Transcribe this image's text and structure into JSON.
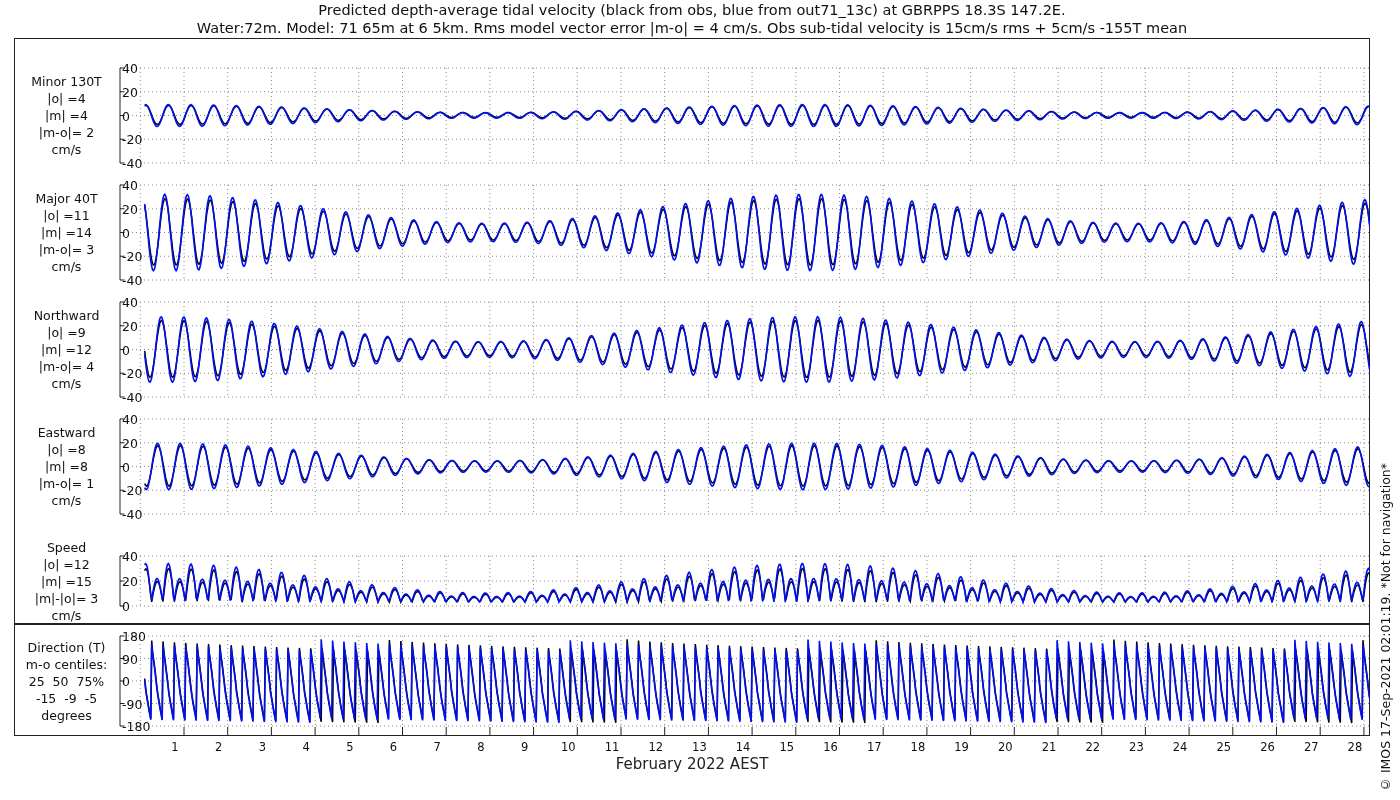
{
  "title_lines": [
    "Predicted depth-average tidal velocity (black from obs, blue from out71_13c) at GBRPPS 18.3S 147.2E.",
    "Water:72m. Model: 71 65m at 6 5km. Rms model vector error |m-o| = 4 cm/s. Obs sub-tidal velocity is 15cm/s rms + 5cm/s -155T mean"
  ],
  "panels": [
    {
      "kind": "velocity",
      "labels": [
        "Minor 130T",
        "|o| =4",
        "|m| =4",
        "|m-o|= 2",
        "cm/s"
      ],
      "yticks": [
        "40",
        "20",
        "0",
        "-20",
        "-40"
      ]
    },
    {
      "kind": "velocity",
      "labels": [
        "Major 40T",
        "|o| =11",
        "|m| =14",
        "|m-o|= 3",
        "cm/s"
      ],
      "yticks": [
        "40",
        "20",
        "0",
        "-20",
        "-40"
      ]
    },
    {
      "kind": "velocity",
      "labels": [
        "Northward",
        "|o| =9",
        "|m| =12",
        "|m-o|= 4",
        "cm/s"
      ],
      "yticks": [
        "40",
        "20",
        "0",
        "-20",
        "-40"
      ]
    },
    {
      "kind": "velocity",
      "labels": [
        "Eastward",
        "|o| =8",
        "|m| =8",
        "|m-o|= 1",
        "cm/s"
      ],
      "yticks": [
        "40",
        "20",
        "0",
        "-20",
        "-40"
      ]
    },
    {
      "kind": "speed",
      "labels": [
        "Speed",
        "|o| =12",
        "|m| =15",
        "|m|-|o|= 3",
        "cm/s"
      ],
      "yticks": [
        "40",
        "20",
        "0"
      ]
    },
    {
      "kind": "direction",
      "labels": [
        "Direction (T)",
        "m-o centiles:",
        "25  50  75%",
        "-15  -9  -5",
        "degrees"
      ],
      "yticks": [
        "180",
        "90",
        "0",
        "-90",
        "-180"
      ]
    }
  ],
  "x_axis": {
    "ticks": [
      "1",
      "2",
      "3",
      "4",
      "5",
      "6",
      "7",
      "8",
      "9",
      "10",
      "11",
      "12",
      "13",
      "14",
      "15",
      "16",
      "17",
      "18",
      "19",
      "20",
      "21",
      "22",
      "23",
      "24",
      "25",
      "26",
      "27",
      "28"
    ],
    "label": "February 2022 AEST"
  },
  "credit": "© IMOS 17-Sep-2021 02:01:19. *Not for navigation*"
}
